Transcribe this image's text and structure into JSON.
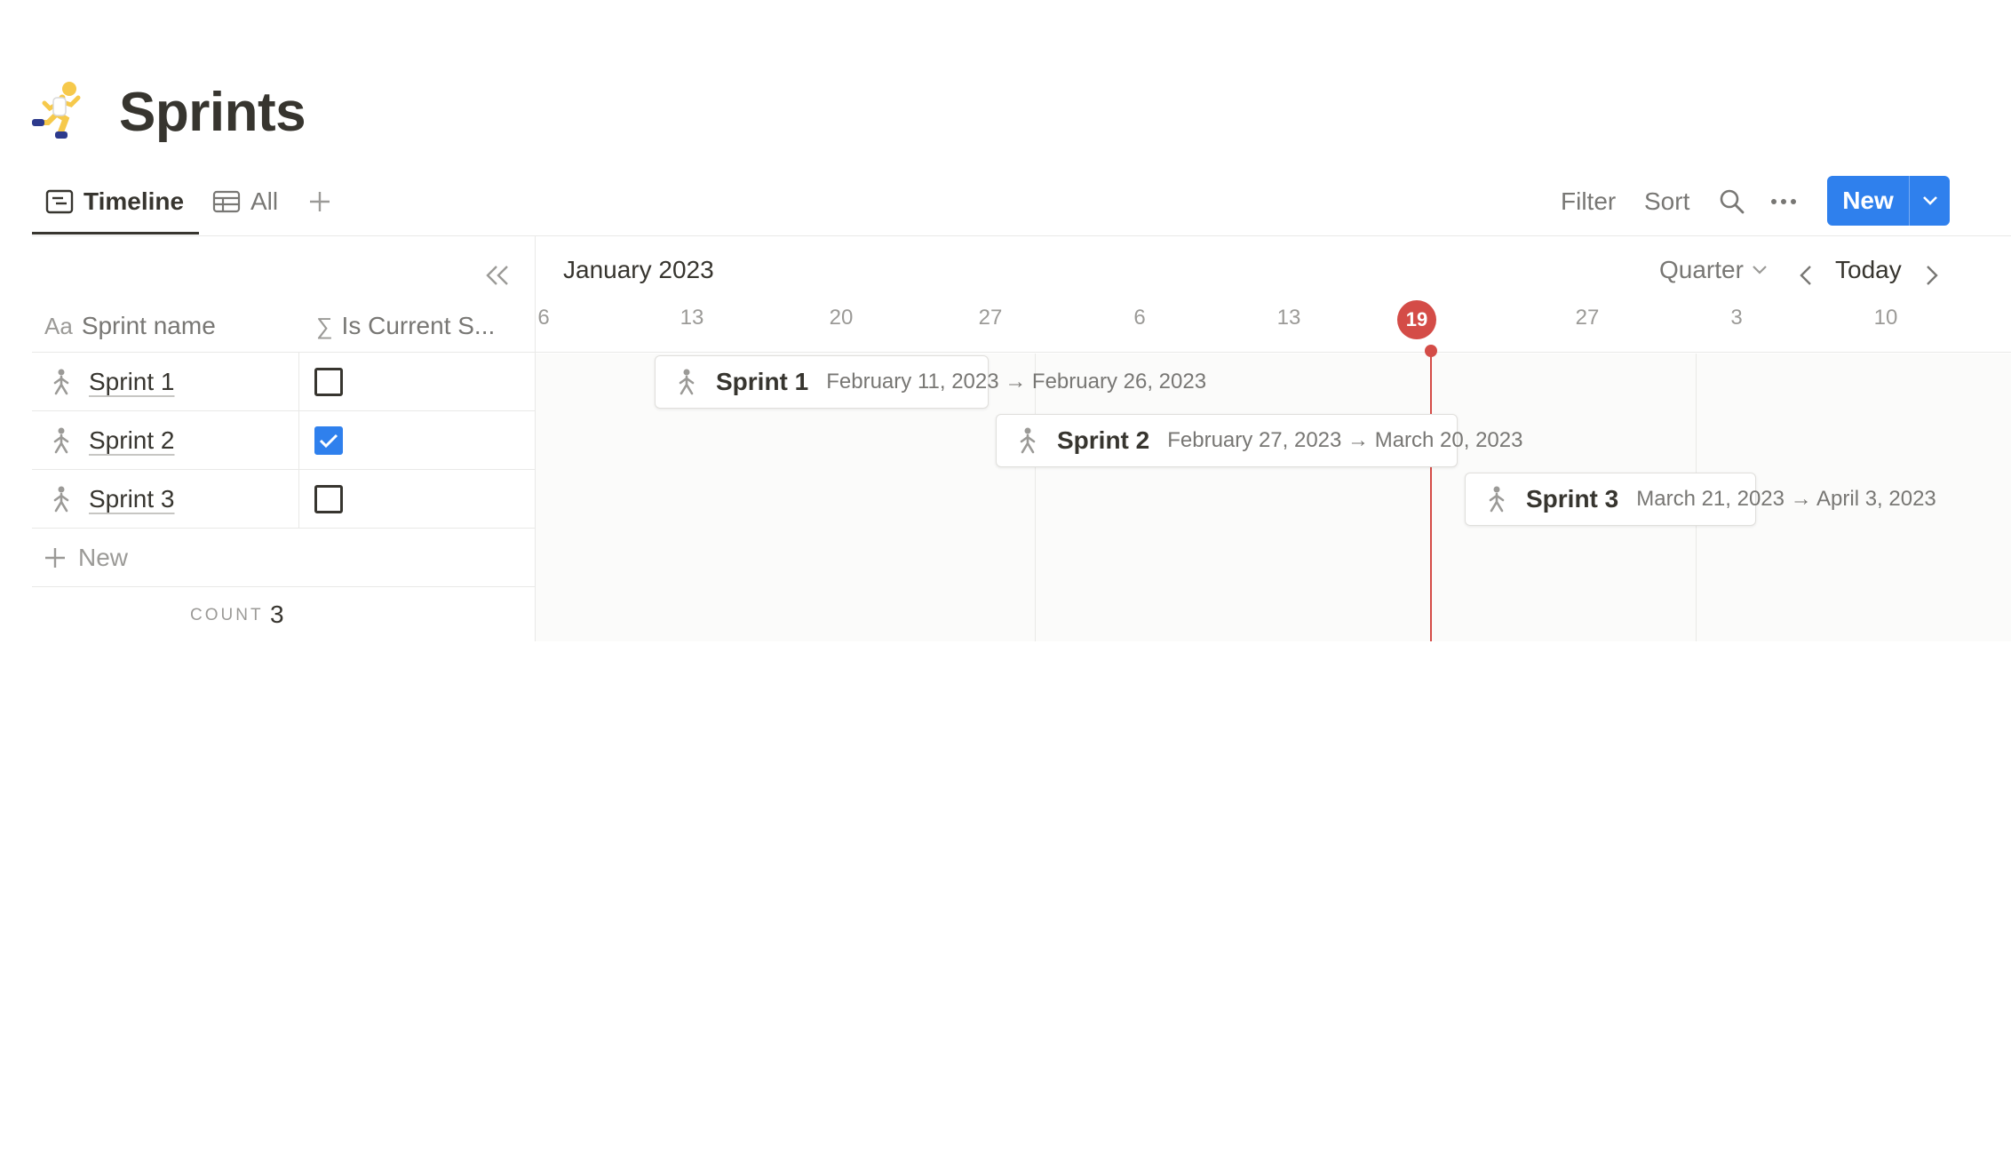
{
  "page": {
    "title": "Sprints",
    "icon": "runner-emoji-icon"
  },
  "tabs": [
    {
      "label": "Timeline",
      "icon": "timeline-icon",
      "active": true
    },
    {
      "label": "All",
      "icon": "table-icon",
      "active": false
    }
  ],
  "toolbar": {
    "filter_label": "Filter",
    "sort_label": "Sort",
    "new_label": "New"
  },
  "table": {
    "columns": [
      {
        "icon_text": "Aa",
        "label": "Sprint name"
      },
      {
        "icon_text": "∑",
        "label": "Is Current S..."
      }
    ],
    "rows": [
      {
        "name": "Sprint 1",
        "is_current": false
      },
      {
        "name": "Sprint 2",
        "is_current": true
      },
      {
        "name": "Sprint 3",
        "is_current": false
      }
    ],
    "new_row_label": "New",
    "count_label": "COUNT",
    "count_value": "3"
  },
  "timeline": {
    "month_label": "January 2023",
    "scale_label": "Quarter",
    "today_label": "Today",
    "today_day": "19",
    "ticks": [
      "6",
      "13",
      "20",
      "27",
      "6",
      "13",
      "27",
      "3",
      "10"
    ],
    "bars": [
      {
        "name": "Sprint 1",
        "dates": "February 11, 2023 → February 26, 2023"
      },
      {
        "name": "Sprint 2",
        "dates": "February 27, 2023 → March 20, 2023"
      },
      {
        "name": "Sprint 3",
        "dates": "March 21, 2023 → April 3, 2023"
      }
    ]
  },
  "colors": {
    "accent": "#2f80ed",
    "today": "#d44c47",
    "text": "#37352f",
    "muted": "#787774"
  }
}
